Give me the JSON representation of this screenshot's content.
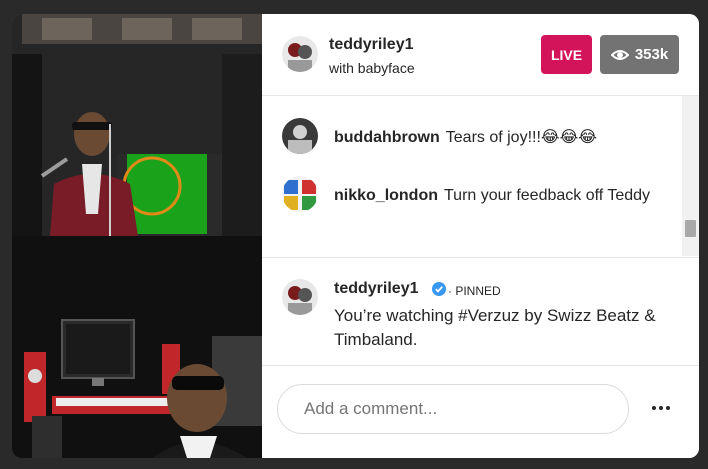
{
  "header": {
    "host_name": "teddyriley1",
    "subtitle": "with babyface",
    "live_label": "LIVE",
    "viewer_count": "353k"
  },
  "comments": [
    {
      "user": "buddahbrown",
      "text": "Tears of joy!!!😂😂😂"
    },
    {
      "user": "nikko_london",
      "text": "Turn your feedback off Teddy"
    }
  ],
  "pinned": {
    "user": "teddyriley1",
    "label": "· PINNED",
    "text": "You’re watching #Verzuz by Swizz Beatz & Timbaland."
  },
  "comment_input": {
    "placeholder": "Add a comment..."
  },
  "colors": {
    "live": "#d4145a",
    "viewers": "#737373",
    "verified": "#3897f0"
  },
  "icons": {
    "viewers": "eye-icon",
    "more": "more-options-icon",
    "verified": "verified-badge-icon"
  }
}
